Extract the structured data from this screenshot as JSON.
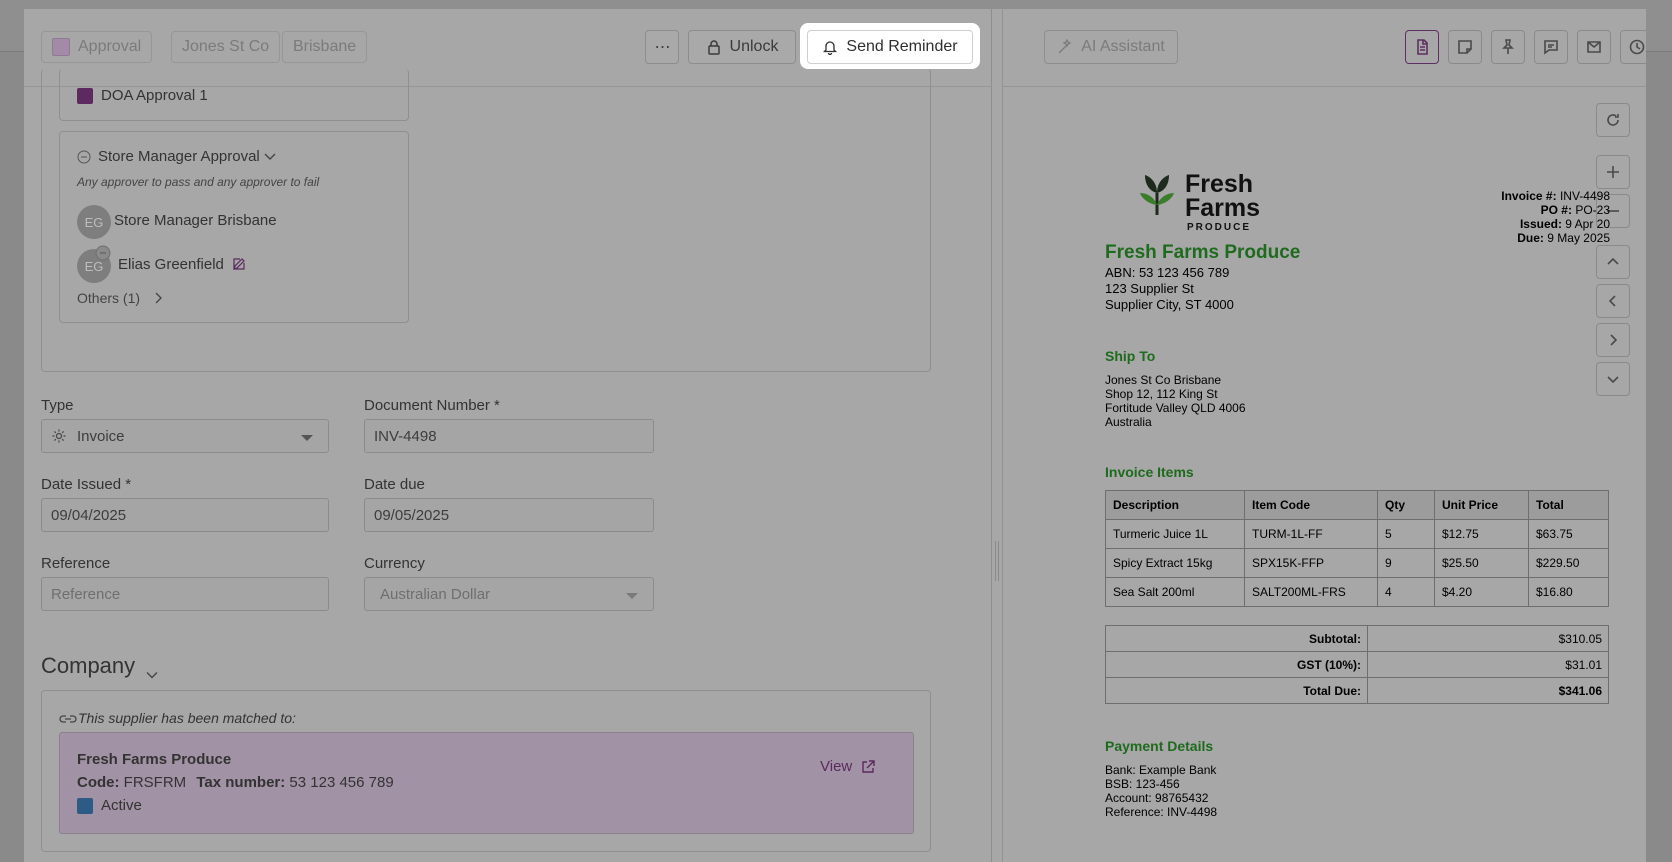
{
  "header": {
    "status_chip": "Approval",
    "company_chip": "Jones St Co",
    "location_chip": "Brisbane",
    "more_label": "⋯",
    "unlock_label": "Unlock",
    "send_reminder_label": "Send Reminder",
    "ai_assistant_label": "AI Assistant"
  },
  "approval": {
    "doa_label": "DOA Approval 1",
    "store_manager_title": "Store Manager Approval",
    "rule_text": "Any approver to pass and any approver to fail",
    "approvers": [
      {
        "initials": "EG",
        "name": "Store Manager Brisbane"
      },
      {
        "initials": "EG",
        "name": "Elias Greenfield"
      }
    ],
    "others_label": "Others (1)"
  },
  "form": {
    "type_label": "Type",
    "type_value": "Invoice",
    "doc_number_label": "Document Number *",
    "doc_number_value": "INV-4498",
    "date_issued_label": "Date Issued *",
    "date_issued_value": "09/04/2025",
    "date_due_label": "Date due",
    "date_due_value": "09/05/2025",
    "reference_label": "Reference",
    "reference_placeholder": "Reference",
    "currency_label": "Currency",
    "currency_value": "Australian Dollar"
  },
  "company": {
    "section_title": "Company",
    "matched_text": "This supplier has been matched to:",
    "name": "Fresh Farms Produce",
    "code_label": "Code:",
    "code_value": "FRSFRM",
    "tax_label": "Tax number:",
    "tax_value": "53 123 456 789",
    "status": "Active",
    "view_label": "View"
  },
  "invoice": {
    "logo_line1": "Fresh",
    "logo_line2": "Farms",
    "logo_line3": "PRODUCE",
    "invoice_no_label": "Invoice #:",
    "invoice_no_value": "INV-4498",
    "po_label": "PO #:",
    "po_value": "PO-23",
    "issued_label": "Issued:",
    "issued_value": "9 Apr 20",
    "due_label": "Due:",
    "due_value": "9 May 2025",
    "supplier_name": "Fresh Farms Produce",
    "abn": "ABN: 53 123 456 789",
    "address1": "123 Supplier St",
    "address2": "Supplier City, ST 4000",
    "ship_to_heading": "Ship To",
    "ship_lines": [
      "Jones St Co Brisbane",
      "Shop 12, 112 King St",
      "Fortitude Valley QLD 4006",
      "Australia"
    ],
    "items_heading": "Invoice Items",
    "columns": [
      "Description",
      "Item Code",
      "Qty",
      "Unit Price",
      "Total"
    ],
    "rows": [
      [
        "Turmeric Juice 1L",
        "TURM-1L-FF",
        "5",
        "$12.75",
        "$63.75"
      ],
      [
        "Spicy Extract 15kg",
        "SPX15K-FFP",
        "9",
        "$25.50",
        "$229.50"
      ],
      [
        "Sea Salt 200ml",
        "SALT200ML-FRS",
        "4",
        "$4.20",
        "$16.80"
      ]
    ],
    "subtotal_label": "Subtotal:",
    "subtotal_value": "$310.05",
    "gst_label": "GST (10%):",
    "gst_value": "$31.01",
    "total_label": "Total Due:",
    "total_value": "$341.06",
    "payment_heading": "Payment Details",
    "payment_lines": [
      "Bank: Example Bank",
      "BSB: 123-456",
      "Account: 98765432",
      "Reference: INV-4498"
    ]
  },
  "colors": {
    "overlay": "#a7a7a7",
    "spotlight": "#ffffff",
    "invoice_green": "#1e6b1e",
    "brand_purple": "#6b2d6f"
  }
}
